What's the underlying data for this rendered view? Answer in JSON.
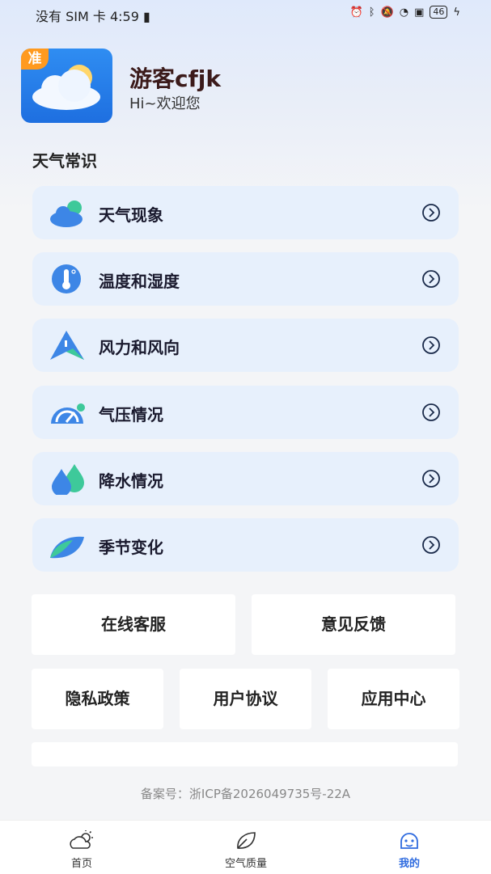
{
  "status_bar": {
    "carrier": "没有 SIM 卡",
    "time": "4:59",
    "battery": "46"
  },
  "profile": {
    "logo_tag": "准",
    "username": "游客cfjk",
    "greeting": "Hi~欢迎您"
  },
  "section_title": "天气常识",
  "items": [
    {
      "label": "天气现象",
      "icon": "cloud-icon"
    },
    {
      "label": "温度和湿度",
      "icon": "thermometer-icon"
    },
    {
      "label": "风力和风向",
      "icon": "wind-direction-icon"
    },
    {
      "label": "气压情况",
      "icon": "gauge-icon"
    },
    {
      "label": "降水情况",
      "icon": "droplet-icon"
    },
    {
      "label": "季节变化",
      "icon": "leaf-icon"
    }
  ],
  "cards": {
    "online_service": "在线客服",
    "feedback": "意见反馈",
    "privacy": "隐私政策",
    "user_agreement": "用户协议",
    "app_center": "应用中心"
  },
  "footer": {
    "icp": "备案号：浙ICP备2026049735号-22A"
  },
  "tabs": [
    {
      "label": "首页",
      "icon": "sun-cloud-icon",
      "active": false
    },
    {
      "label": "空气质量",
      "icon": "leaf-outline-icon",
      "active": false
    },
    {
      "label": "我的",
      "icon": "user-icon",
      "active": true
    }
  ],
  "colors": {
    "accent": "#2f6bdf",
    "item_bg": "#e7f0fc",
    "logo_tag": "#ff9a1f"
  }
}
